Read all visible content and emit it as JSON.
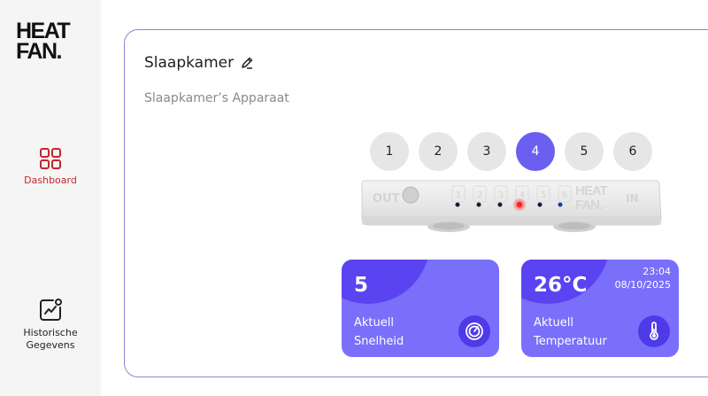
{
  "brand": {
    "logo_line1": "HEAT",
    "logo_line2": "FAN."
  },
  "sidebar": {
    "items": [
      {
        "label": "Dashboard",
        "icon": "dashboard-grid-icon",
        "active": true
      },
      {
        "label": "Historische Gegevens",
        "icon": "history-chart-icon",
        "active": false
      }
    ]
  },
  "room": {
    "title": "Slaapkamer",
    "edit_icon": "pencil-icon",
    "device_label": "Slaapkamer’s Apparaat"
  },
  "speed_selector": {
    "levels": [
      "1",
      "2",
      "3",
      "4",
      "5",
      "6"
    ],
    "selected": "4"
  },
  "device_image": {
    "out_label": "OUT",
    "in_label": "IN",
    "brand_top": "HEAT",
    "brand_bottom": "FAN.",
    "slot_numbers": [
      "1",
      "2",
      "3",
      "4",
      "5",
      "6"
    ],
    "led_active_index": 3
  },
  "tiles": {
    "speed": {
      "value": "5",
      "label_line1": "Aktuell",
      "label_line2": "Snelheid",
      "icon": "gauge-icon"
    },
    "temperature": {
      "value": "26°C",
      "label_line1": "Aktuell",
      "label_line2": "Temperatuur",
      "time": "23:04",
      "date": "08/10/2025",
      "icon": "thermometer-icon"
    }
  },
  "colors": {
    "accent": "#6a5ff0",
    "tile": "#7a6ffa",
    "tile_dark": "#5a43f0",
    "active_nav": "#c1272d",
    "border": "#8c87d4"
  }
}
